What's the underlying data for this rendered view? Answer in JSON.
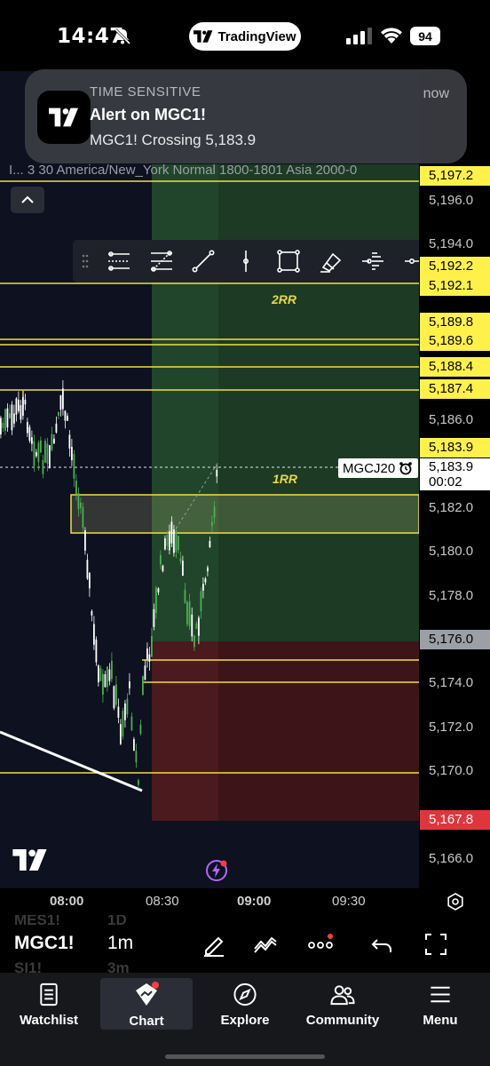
{
  "status_bar": {
    "time": "14:47",
    "app_pill": "TradingView",
    "battery": "94"
  },
  "notification": {
    "app_name": "TIME SENSITIVE",
    "title": "Alert on MGC1!",
    "body": "MGC1! Crossing 5,183.9",
    "time": "now"
  },
  "chart": {
    "indicator_text": "I... 3 30 America/New_York Normal 1800-1801 Asia 2000-0",
    "symbol_tag": "MGCJ20",
    "rr_labels": [
      "2RR",
      "1RR"
    ],
    "price_ticks": [
      "5,196.0",
      "5,194.0",
      "5,186.0",
      "5,182.0",
      "5,180.0",
      "5,178.0",
      "5,174.0",
      "5,172.0",
      "5,170.0",
      "5,166.0"
    ],
    "price_tags": {
      "p5197_2": "5,197.2",
      "p5192_2": "5,192.2",
      "p5192_1": "5,192.1",
      "p5189_8": "5,189.8",
      "p5189_6": "5,189.6",
      "p5188_4": "5,188.4",
      "p5187_4": "5,187.4",
      "p5183_9": "5,183.9",
      "last_price": "5,183.9",
      "countdown": "00:02",
      "p5176_0": "5,176.0",
      "p5167_8": "5,167.8"
    },
    "colors": {
      "bull": "#4caf50",
      "bear": "#ffffff",
      "level": "#f0e040",
      "profit_zone": "#1c3a24",
      "loss_zone": "#3d1418"
    }
  },
  "time_axis": [
    "08:00",
    "08:30",
    "09:00",
    "09:30"
  ],
  "bottom_bar": {
    "symbol": "MGC1!",
    "interval": "1m",
    "ghost_symbols": [
      "MES1!",
      "SI1!"
    ],
    "ghost_intervals": [
      "1D",
      "3m"
    ]
  },
  "tabs": [
    {
      "label": "Watchlist",
      "icon": "watchlist-icon"
    },
    {
      "label": "Chart",
      "icon": "chart-icon"
    },
    {
      "label": "Explore",
      "icon": "compass-icon"
    },
    {
      "label": "Community",
      "icon": "community-icon"
    },
    {
      "label": "Menu",
      "icon": "menu-icon"
    }
  ]
}
